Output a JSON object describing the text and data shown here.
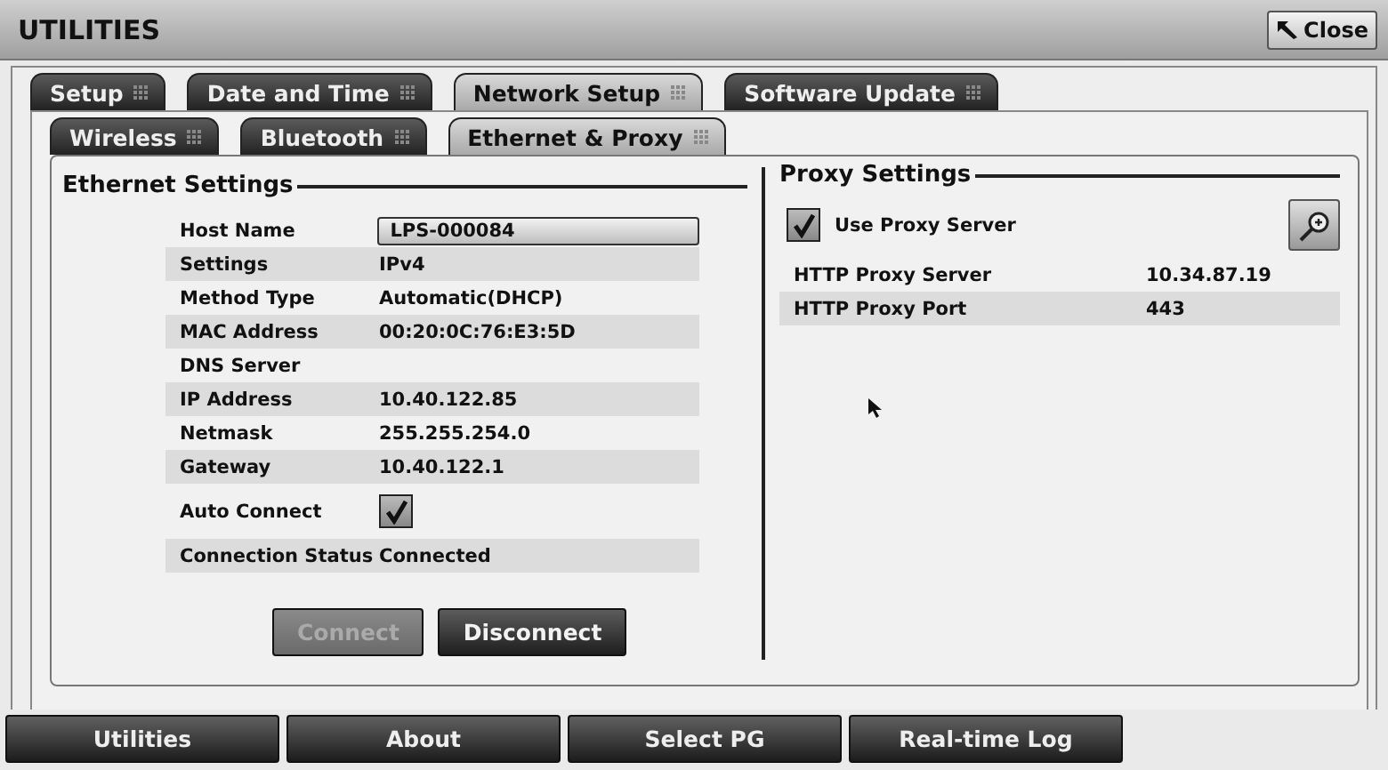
{
  "window": {
    "title": "UTILITIES",
    "close_button": "Close"
  },
  "tabs": [
    {
      "label": "Setup",
      "selected": false
    },
    {
      "label": "Date and Time",
      "selected": false
    },
    {
      "label": "Network Setup",
      "selected": true
    },
    {
      "label": "Software Update",
      "selected": false
    }
  ],
  "subtabs": [
    {
      "label": "Wireless",
      "selected": false
    },
    {
      "label": "Bluetooth",
      "selected": false
    },
    {
      "label": "Ethernet & Proxy",
      "selected": true
    }
  ],
  "ethernet": {
    "title": "Ethernet Settings",
    "rows": [
      {
        "kind": "field",
        "label": "Host Name",
        "value": "LPS-000084"
      },
      {
        "kind": "text",
        "label": "Settings",
        "value": "IPv4"
      },
      {
        "kind": "text",
        "label": "Method Type",
        "value": "Automatic(DHCP)"
      },
      {
        "kind": "text",
        "label": "MAC Address",
        "value": "00:20:0C:76:E3:5D"
      },
      {
        "kind": "text",
        "label": "DNS Server",
        "value": ""
      },
      {
        "kind": "text",
        "label": "IP Address",
        "value": "10.40.122.85"
      },
      {
        "kind": "text",
        "label": "Netmask",
        "value": "255.255.254.0"
      },
      {
        "kind": "text",
        "label": "Gateway",
        "value": "10.40.122.1"
      },
      {
        "kind": "checkbox",
        "label": "Auto Connect",
        "checked": true
      },
      {
        "kind": "text",
        "label": "Connection Status",
        "value": "Connected"
      }
    ],
    "buttons": [
      {
        "label": "Connect",
        "disabled": true
      },
      {
        "label": "Disconnect",
        "disabled": false
      }
    ]
  },
  "proxy": {
    "title": "Proxy Settings",
    "use_proxy": {
      "label": "Use Proxy Server",
      "checked": true
    },
    "rows": [
      {
        "label": "HTTP Proxy Server",
        "value": "10.34.87.19"
      },
      {
        "label": "HTTP Proxy Port",
        "value": "443"
      }
    ]
  },
  "bottom_buttons": [
    "Utilities",
    "About",
    "Select PG",
    "Real-time Log"
  ]
}
